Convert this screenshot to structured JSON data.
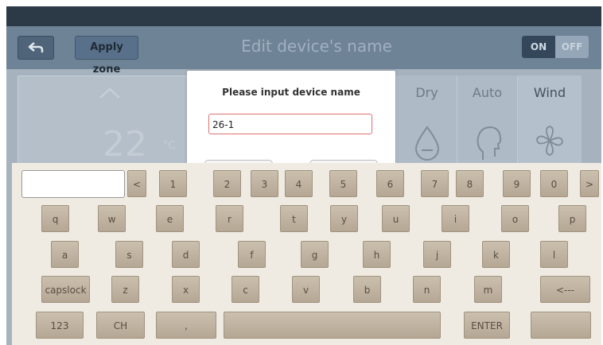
{
  "header": {
    "back_icon": "back-arrow-icon",
    "apply_label": "Apply zone",
    "title": "Edit device's name",
    "on_label": "ON",
    "off_label": "OFF"
  },
  "temperature": {
    "value": "22",
    "unit": "°C",
    "up_icon": "chevron-up-icon"
  },
  "modes": [
    {
      "label": "Dry",
      "icon": "droplet-icon"
    },
    {
      "label": "Auto",
      "icon": "head-profile-icon"
    },
    {
      "label": "Wind",
      "icon": "fan-icon"
    }
  ],
  "dialog": {
    "prompt": "Please input device name",
    "value": "26-1"
  },
  "keyboard": {
    "rows": [
      [
        "<",
        "1",
        "2",
        "3",
        "4",
        "5",
        "6",
        "7",
        "8",
        "9",
        "0",
        ">"
      ],
      [
        "q",
        "w",
        "e",
        "r",
        "t",
        "y",
        "u",
        "i",
        "o",
        "p"
      ],
      [
        "a",
        "s",
        "d",
        "f",
        "g",
        "h",
        "j",
        "k",
        "l"
      ],
      [
        "capslock",
        "z",
        "x",
        "c",
        "v",
        "b",
        "n",
        "m",
        "<---"
      ],
      [
        "123",
        "CH",
        ",",
        "",
        "ENTER",
        ""
      ]
    ]
  },
  "colors": {
    "header_bg": "#6f8396",
    "screen_bg": "#a6b3bf",
    "keyboard_bg": "#f0ebe2",
    "key_bg": "#c3b7a6",
    "input_border": "#e07070"
  }
}
